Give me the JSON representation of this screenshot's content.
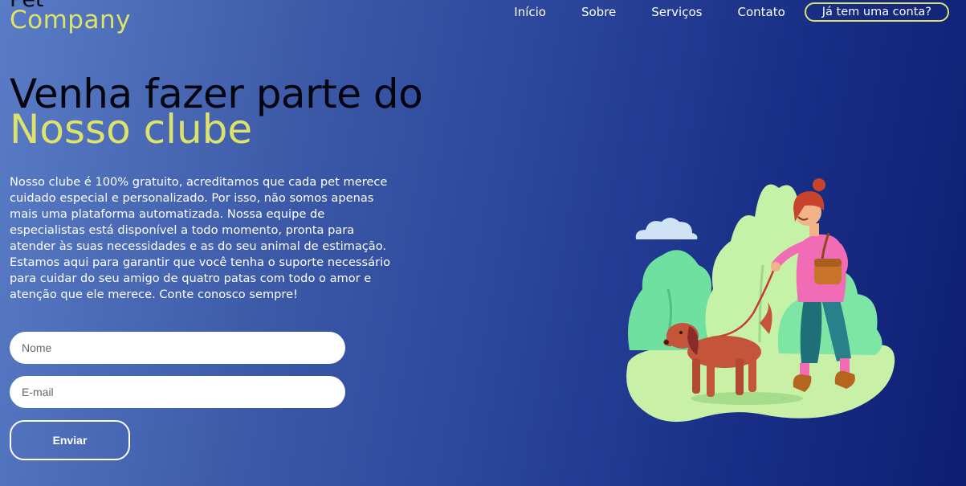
{
  "brand": {
    "line1": "Pet",
    "line2": "Company"
  },
  "nav": {
    "items": [
      {
        "label": "Início"
      },
      {
        "label": "Sobre"
      },
      {
        "label": "Serviços"
      },
      {
        "label": "Contato"
      }
    ],
    "account_label": "Já tem uma conta?"
  },
  "hero": {
    "title_line1": "Venha fazer parte do",
    "title_line2": "Nosso clube",
    "description": "Nosso clube é 100% gratuito, acreditamos que cada pet merece cuidado especial e personalizado. Por isso, não somos apenas mais uma plataforma automatizada. Nossa equipe de especialistas está disponível a todo momento, pronta para atender às suas necessidades e as do seu animal de estimação. Estamos aqui para garantir que você tenha o suporte necessário para cuidar do seu amigo de quatro patas com todo o amor e atenção que ele merece. Conte conosco sempre!"
  },
  "form": {
    "name_placeholder": "Nome",
    "name_value": "",
    "email_placeholder": "E-mail",
    "email_value": "",
    "submit_label": "Enviar"
  },
  "colors": {
    "accent": "#dde26a",
    "background_start": "#5a7cc6",
    "background_end": "#0e1f72",
    "title_dark": "#050510"
  },
  "illustration": {
    "icon": "woman-walking-dog-illustration"
  }
}
